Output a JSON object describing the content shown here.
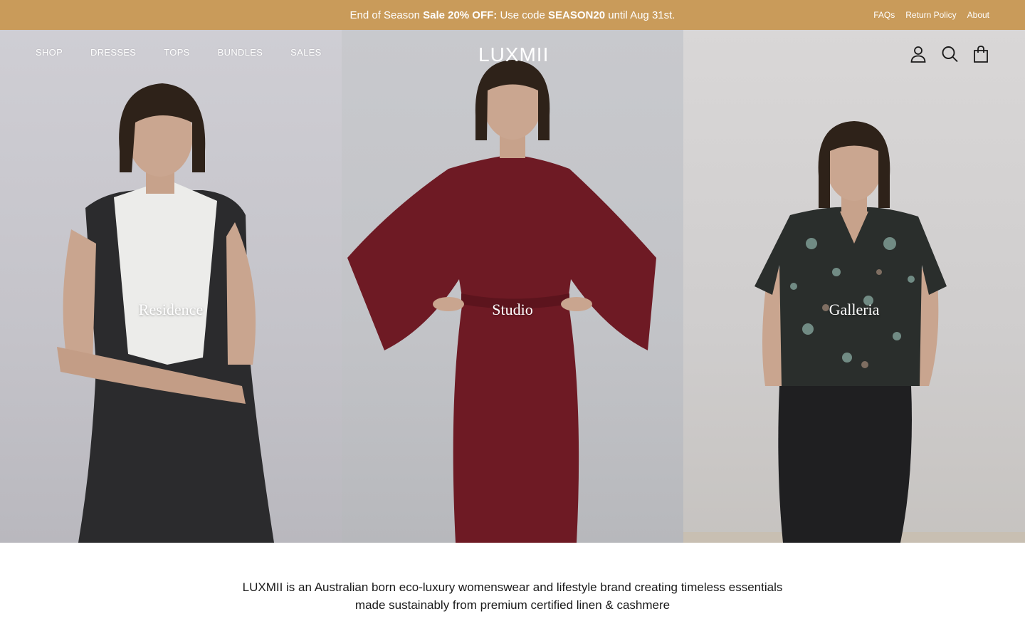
{
  "announcement": {
    "prefix": "End of Season ",
    "bold_1": "Sale 20% OFF:",
    "middle": " Use code ",
    "bold_2": "SEASON20",
    "suffix": " until Aug 31st."
  },
  "top_links": [
    "FAQs",
    "Return Policy",
    "About"
  ],
  "nav": [
    "SHOP",
    "DRESSES",
    "TOPS",
    "BUNDLES",
    "SALES"
  ],
  "brand": "LUXMII",
  "header_icons": [
    "account-icon",
    "search-icon",
    "cart-icon"
  ],
  "collections": [
    {
      "label": "Residence"
    },
    {
      "label": "Studio"
    },
    {
      "label": "Galleria"
    }
  ],
  "tagline": {
    "line_1": "LUXMII is an Australian born eco-luxury womenswear and lifestyle brand creating timeless essentials",
    "line_2": "made sustainably from premium certified linen & cashmere"
  },
  "colors": {
    "announcement_bg": "#c99b5a",
    "studio_dress": "#6e1a24"
  }
}
